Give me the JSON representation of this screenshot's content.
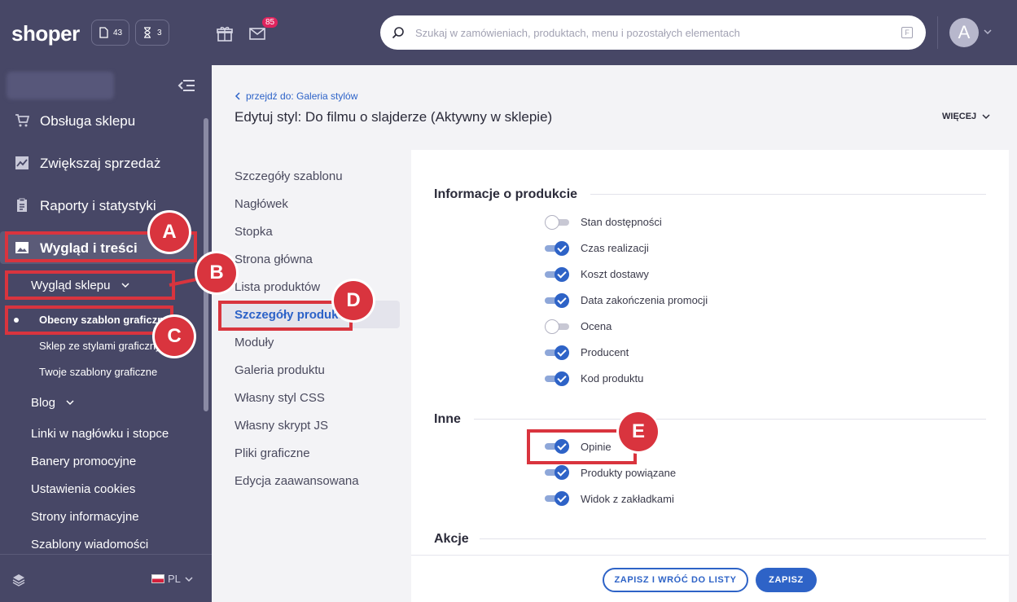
{
  "topbar": {
    "logo": "shoper",
    "orders_count": "43",
    "pending_count": "3",
    "mail_count": "85",
    "search_placeholder": "Szukaj w zamówieniach, produktach, menu i pozostałych elementach",
    "search_shortcut": "F",
    "avatar_letter": "A"
  },
  "sidebar": {
    "main_items": [
      {
        "label": "Obsługa sklepu",
        "icon": "cart-icon"
      },
      {
        "label": "Zwiększaj sprzedaż",
        "icon": "chart-icon"
      },
      {
        "label": "Raporty i statystyki",
        "icon": "clipboard-icon"
      },
      {
        "label": "Wygląd i treści",
        "icon": "image-icon"
      }
    ],
    "sub_wyglad_sklepu": "Wygląd sklepu",
    "sub2_items": [
      "Obecny szablon graficzny",
      "Sklep ze stylami graficzny",
      "Twoje szablony graficzne"
    ],
    "sub_items": [
      "Blog",
      "Linki w nagłówku i stopce",
      "Banery promocyjne",
      "Ustawienia cookies",
      "Strony informacyjne",
      "Szablony wiadomości"
    ],
    "language": "PL"
  },
  "main": {
    "back_link": "przejdź do: Galeria stylów",
    "title": "Edytuj styl: Do filmu o slajderze (Aktywny w sklepie)",
    "more": "WIĘCEJ",
    "submenu": [
      "Szczegóły szablonu",
      "Nagłówek",
      "Stopka",
      "Strona główna",
      "Lista produktów",
      "Szczegóły produktu",
      "Moduły",
      "Galeria produktu",
      "Własny styl CSS",
      "Własny skrypt JS",
      "Pliki graficzne",
      "Edycja zaawansowana"
    ],
    "submenu_active": "Szczegóły produktu"
  },
  "panel": {
    "section1_title": "Informacje o produkcie",
    "section1_options": [
      {
        "label": "Stan dostępności",
        "checked": false
      },
      {
        "label": "Czas realizacji",
        "checked": true
      },
      {
        "label": "Koszt dostawy",
        "checked": true
      },
      {
        "label": "Data zakończenia promocji",
        "checked": true
      },
      {
        "label": "Ocena",
        "checked": false
      },
      {
        "label": "Producent",
        "checked": true
      },
      {
        "label": "Kod produktu",
        "checked": true
      }
    ],
    "section2_title": "Inne",
    "section2_options": [
      {
        "label": "Opinie",
        "checked": true
      },
      {
        "label": "Produkty powiązane",
        "checked": true
      },
      {
        "label": "Widok z zakładkami",
        "checked": true
      }
    ],
    "section3_title": "Akcje",
    "save_back_label": "ZAPISZ I WRÓĆ DO LISTY",
    "save_label": "ZAPISZ"
  },
  "annotations": {
    "a": "A",
    "b": "B",
    "c": "C",
    "d": "D",
    "e": "E"
  },
  "colors": {
    "sidebar": "#474766",
    "accent": "#2e63c7",
    "annotation": "#d9343e"
  }
}
